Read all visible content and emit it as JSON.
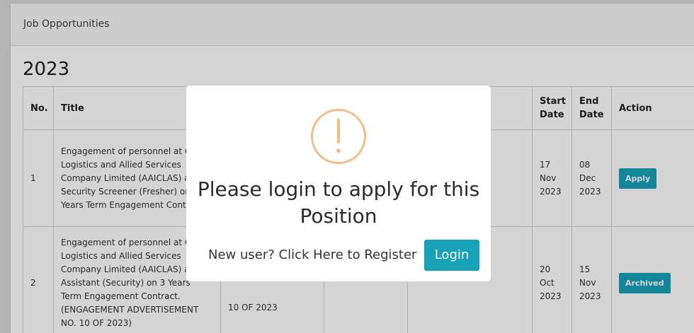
{
  "card": {
    "header_title": "Job Opportunities",
    "year": "2023"
  },
  "table": {
    "headers": [
      "No.",
      "Title",
      "",
      "",
      "",
      "Start Date",
      "End Date",
      "Action"
    ],
    "rows": [
      {
        "no": "1",
        "title": "Engagement of personnel at Cargo Logistics and Allied Services Company Limited (AAICLAS) as Security Screener (Fresher) on 3 Years Term Engagement Contract.",
        "ref": "",
        "file": "",
        "start_date": "17 Nov 2023",
        "end_date": "08 Dec 2023",
        "action": "Apply"
      },
      {
        "no": "2",
        "title": "Engagement of personnel at Cargo Logistics and Allied Services Company Limited (AAICLAS) as Assistant (Security) on 3 Years Term Engagement Contract. (ENGAGEMENT ADVERTISEMENT NO. 10 OF 2023)",
        "ref": "10 OF 2023",
        "file": "",
        "start_date": "20 Oct 2023",
        "end_date": "15 Nov 2023",
        "action": "Archived"
      }
    ]
  },
  "modal": {
    "icon": "warning-exclamation-icon",
    "title": "Please login to apply for this Position",
    "register_text": "New user? Click Here to Register",
    "login_label": "Login"
  },
  "colors": {
    "accent": "#17a2b8",
    "warning": "#f8bb86"
  }
}
